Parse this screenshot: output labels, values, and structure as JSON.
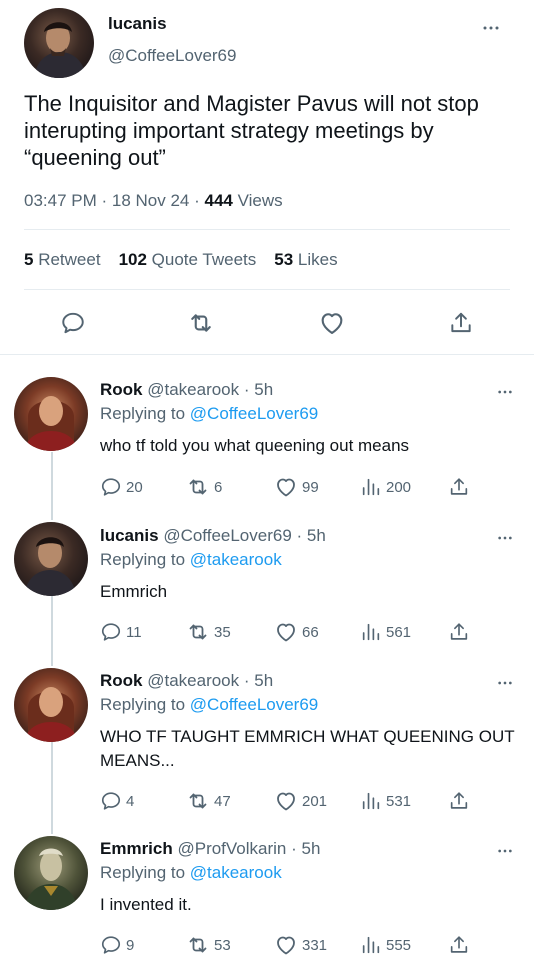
{
  "main_tweet": {
    "name": "lucanis",
    "handle": "@CoffeeLover69",
    "text": "The Inquisitor and Magister Pavus will not stop interupting important strategy meetings by “queening out”",
    "time": "03:47 PM · 18 Nov 24 · ",
    "views_count": "444",
    "views_label": " Views",
    "retweet_count": "5",
    "retweet_label": " Retweet",
    "quote_count": "102",
    "quote_label": " Quote Tweets",
    "likes_count": "53",
    "likes_label": " Likes",
    "icons": [
      "reply-icon",
      "retweet-icon",
      "like-icon",
      "share-icon"
    ]
  },
  "replies": [
    {
      "name": "Rook",
      "handle": " @takearook · 5h",
      "replying_prefix": "Replying to ",
      "replying_to": "@CoffeeLover69",
      "text": "who tf told you what queening out means",
      "reply_count": "20",
      "retweet_count": "6",
      "like_count": "99",
      "view_count": "200"
    },
    {
      "name": "lucanis",
      "handle": " @CoffeeLover69 · 5h",
      "replying_prefix": "Replying to ",
      "replying_to": "@takearook",
      "text": "Emmrich",
      "reply_count": "11",
      "retweet_count": "35",
      "like_count": "66",
      "view_count": "561"
    },
    {
      "name": "Rook",
      "handle": " @takearook · 5h",
      "replying_prefix": "Replying to ",
      "replying_to": "@CoffeeLover69",
      "text": "WHO TF TAUGHT EMMRICH WHAT QUEENING OUT MEANS...",
      "reply_count": "4",
      "retweet_count": "47",
      "like_count": "201",
      "view_count": "531"
    },
    {
      "name": "Emmrich",
      "handle": " @ProfVolkarin · 5h",
      "replying_prefix": "Replying to ",
      "replying_to": "@takearook",
      "text": "I invented it.",
      "reply_count": "9",
      "retweet_count": "53",
      "like_count": "331",
      "view_count": "555"
    }
  ],
  "colors": {
    "link": "#1d9bf0",
    "secondary_text": "#536471",
    "primary_text": "#0f1419",
    "divider": "#e6ecf0"
  }
}
